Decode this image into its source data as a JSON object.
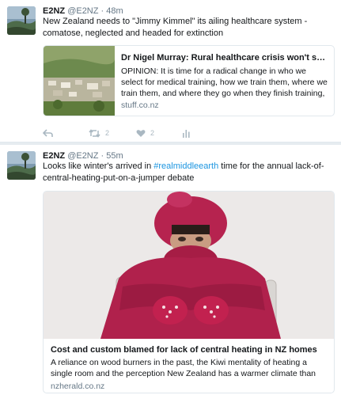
{
  "tweets": [
    {
      "name": "E2NZ",
      "handle": "@E2NZ",
      "separator": "·",
      "time": "48m",
      "text": "New Zealand needs to \"Jimmy Kimmel\" its ailing healthcare system - comatose, neglected and headed for extinction",
      "card": {
        "title": "Dr Nigel Murray: Rural healthcare crisis won't solve...",
        "description": "OPINION: It is time for a radical change in who we select for medical training, how we train them, where we train them, and where they go when they finish training, write...",
        "domain": "stuff.co.nz"
      },
      "actions": {
        "reply_icon": "reply-icon",
        "retweet_icon": "retweet-icon",
        "retweet_count": "2",
        "like_icon": "heart-icon",
        "like_count": "2",
        "analytics_icon": "analytics-icon"
      }
    },
    {
      "name": "E2NZ",
      "handle": "@E2NZ",
      "separator": "·",
      "time": "55m",
      "text_before": "Looks like winter's arrived in ",
      "hashtag": "#realmiddleearth",
      "text_after": " time for the annual lack-of-central-heating-put-on-a-jumper debate",
      "card": {
        "title": "Cost and custom blamed for lack of central heating in NZ homes",
        "description": "A reliance on wood burners in the past, the Kiwi mentality of heating a single room and the perception New Zealand has a warmer climate than Europ...",
        "domain": "nzherald.co.nz"
      }
    }
  ],
  "colors": {
    "background": "#e6ecf0",
    "text": "#14171a",
    "secondary": "#657786",
    "link": "#1b95e0",
    "icon": "#aab8c2"
  }
}
